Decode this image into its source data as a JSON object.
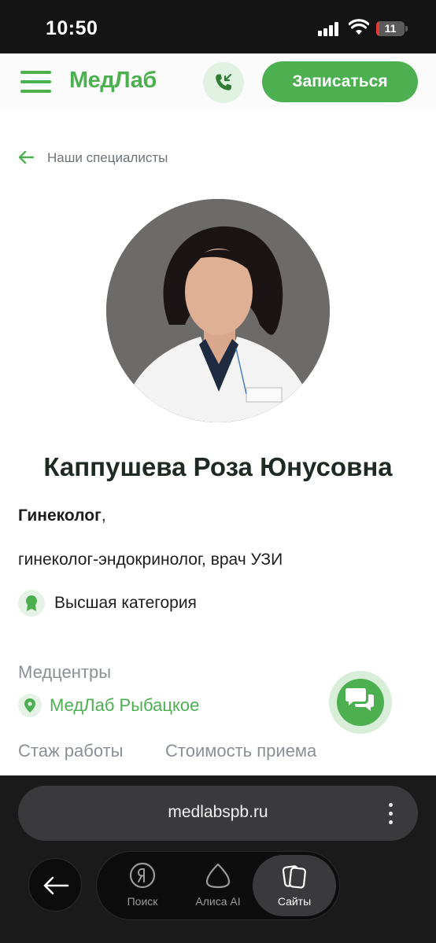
{
  "status_bar": {
    "time": "10:50",
    "battery": "11",
    "battery_level": 0.11
  },
  "header": {
    "logo": "МедЛаб",
    "signup_label": "Записаться"
  },
  "breadcrumb": {
    "back_label": "Наши специалисты"
  },
  "doctor": {
    "name": "Каппушева Роза Юнусовна",
    "specialty": "Гинеколог",
    "specialty_suffix": ",",
    "specialties_extra": "гинеколог-эндокринолог, врач УЗИ",
    "category": "Высшая категория",
    "centers_label": "Медцентры",
    "center": "МедЛаб Рыбацкое",
    "experience_label": "Стаж работы",
    "price_label": "Стоимость приема"
  },
  "browser": {
    "url": "medlabspb.ru",
    "tabs": [
      {
        "label": "Поиск",
        "icon": "yandex-icon"
      },
      {
        "label": "Алиса AI",
        "icon": "alice-icon"
      },
      {
        "label": "Сайты",
        "icon": "tabs-icon"
      }
    ]
  },
  "colors": {
    "brand": "#4caf50",
    "brand_light": "#e5f2e5",
    "text": "#1d1d1d",
    "muted": "#8a8f96"
  }
}
